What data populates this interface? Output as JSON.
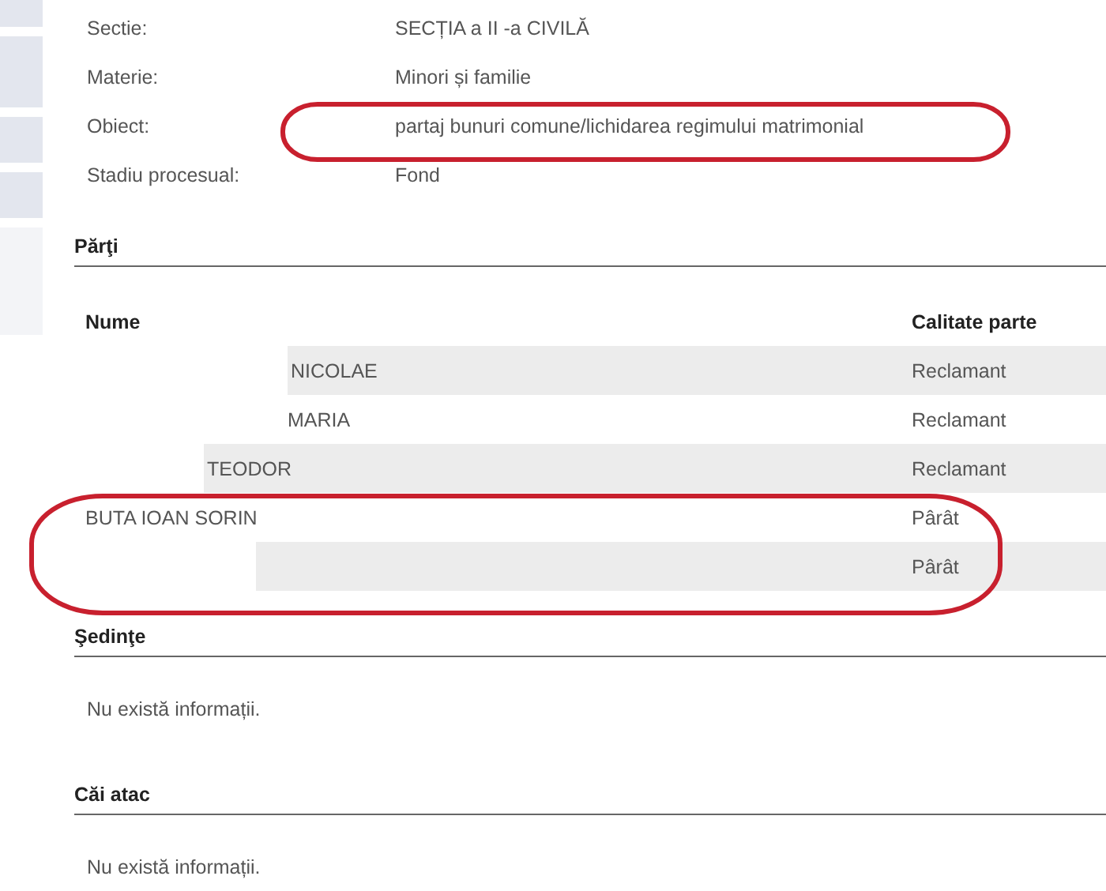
{
  "details": [
    {
      "label": "Sectie:",
      "value": "SECȚIA a II -a CIVILĂ"
    },
    {
      "label": "Materie:",
      "value": "Minori și familie"
    },
    {
      "label": "Obiect:",
      "value": "partaj bunuri comune/lichidarea regimului matrimonial"
    },
    {
      "label": "Stadiu procesual:",
      "value": "Fond"
    }
  ],
  "parties": {
    "title": "Părţi",
    "columns": [
      "Nume",
      "Calitate parte"
    ],
    "rows": [
      {
        "name": "NICOLAE",
        "role": "Reclamant"
      },
      {
        "name": "MARIA",
        "role": "Reclamant"
      },
      {
        "name": "TEODOR",
        "role": "Reclamant"
      },
      {
        "name": "BUTA IOAN SORIN",
        "role": "Pârât"
      },
      {
        "role": "Pârât"
      }
    ]
  },
  "sections": [
    {
      "title": "Şedinţe",
      "message": "Nu există informații."
    },
    {
      "title": "Căi atac",
      "message": "Nu există informații."
    }
  ]
}
